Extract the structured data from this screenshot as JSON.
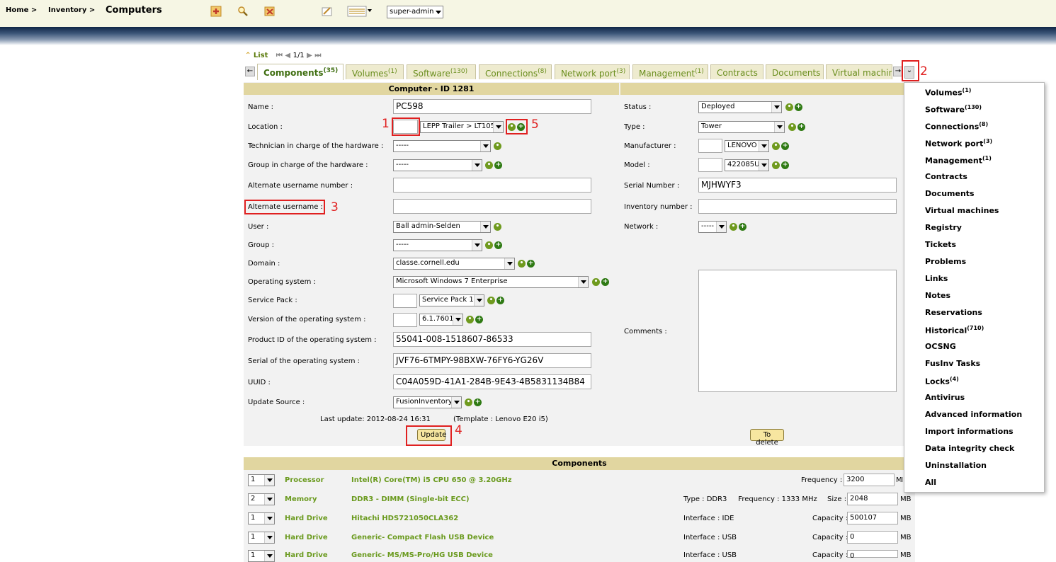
{
  "header": {
    "breadcrumb": [
      "Home >",
      "Inventory >"
    ],
    "title": "Computers",
    "profile_select": "super-admin"
  },
  "list_nav": {
    "label": "List",
    "pager": "1/1"
  },
  "tabs": [
    {
      "label": "Components",
      "count": "(35)"
    },
    {
      "label": "Volumes",
      "count": "(1)"
    },
    {
      "label": "Software",
      "count": "(130)"
    },
    {
      "label": "Connections",
      "count": "(8)"
    },
    {
      "label": "Network port",
      "count": "(3)"
    },
    {
      "label": "Management",
      "count": "(1)"
    },
    {
      "label": "Contracts",
      "count": ""
    },
    {
      "label": "Documents",
      "count": ""
    },
    {
      "label": "Virtual machin",
      "count": ""
    }
  ],
  "form": {
    "header": "Computer - ID 1281",
    "left": [
      {
        "label": "Name :",
        "value": "PC598"
      },
      {
        "label": "Location :",
        "value": "LEPP Trailer > LT105"
      },
      {
        "label": "Technician in charge of the hardware :",
        "value": "-----"
      },
      {
        "label": "Group in charge of the hardware :",
        "value": "-----"
      },
      {
        "label": "Alternate username number :",
        "value": ""
      },
      {
        "label": "Alternate username :",
        "value": ""
      },
      {
        "label": "User :",
        "value": "Ball admin-Selden"
      },
      {
        "label": "Group :",
        "value": "-----"
      },
      {
        "label": "Domain :",
        "value": "classe.cornell.edu"
      },
      {
        "label": "Operating system :",
        "value": "Microsoft Windows 7 Enterprise"
      },
      {
        "label": "Service Pack :",
        "value": "Service Pack 1"
      },
      {
        "label": "Version of the operating system :",
        "value": "6.1.7601"
      },
      {
        "label": "Product ID of the operating system :",
        "value": "55041-008-1518607-86533"
      },
      {
        "label": "Serial of the operating system :",
        "value": "JVF76-6TMPY-98BXW-76FY6-YG26V"
      },
      {
        "label": "UUID :",
        "value": "C04A059D-41A1-284B-9E43-4B5831134B84"
      },
      {
        "label": "Update Source :",
        "value": "FusionInventory"
      }
    ],
    "right": [
      {
        "label": "Status :",
        "value": "Deployed"
      },
      {
        "label": "Type :",
        "value": "Tower"
      },
      {
        "label": "Manufacturer :",
        "value": "LENOVO"
      },
      {
        "label": "Model :",
        "value": "422085U"
      },
      {
        "label": "Serial Number :",
        "value": "MJHWYF3"
      },
      {
        "label": "Inventory number :",
        "value": ""
      },
      {
        "label": "Network :",
        "value": "-----"
      },
      {
        "label": "Comments :",
        "value": ""
      }
    ],
    "last_update": "Last update: 2012-08-24 16:31",
    "template": "(Template : Lenovo E20 i5)",
    "update_button": "Update",
    "delete_button": "To delete"
  },
  "annotations": [
    "1",
    "2",
    "3",
    "4",
    "5"
  ],
  "components": {
    "header": "Components",
    "rows": [
      {
        "qty": "1",
        "type": "Processor",
        "name": "Intel(R) Core(TM) i5 CPU 650 @ 3.20GHz",
        "info": "",
        "field": "Frequency :",
        "value": "3200",
        "unit": "MHz"
      },
      {
        "qty": "2",
        "type": "Memory",
        "name": "DDR3 - DIMM (Single-bit ECC)",
        "info": "Type : DDR3     Frequency : 1333 MHz",
        "field": "Size :",
        "value": "2048",
        "unit": "MB"
      },
      {
        "qty": "1",
        "type": "Hard Drive",
        "name": "Hitachi HDS721050CLA362",
        "info": "Interface : IDE",
        "field": "Capacity :",
        "value": "500107",
        "unit": "MB"
      },
      {
        "qty": "1",
        "type": "Hard Drive",
        "name": "Generic- Compact Flash USB Device",
        "info": "Interface : USB",
        "field": "Capacity :",
        "value": "0",
        "unit": "MB"
      },
      {
        "qty": "1",
        "type": "Hard Drive",
        "name": "Generic- MS/MS-Pro/HG USB Device",
        "info": "Interface : USB",
        "field": "Capacity :",
        "value": "0",
        "unit": "MB"
      }
    ]
  },
  "menu": [
    {
      "label": "Volumes",
      "count": "(1)"
    },
    {
      "label": "Software",
      "count": "(130)"
    },
    {
      "label": "Connections",
      "count": "(8)"
    },
    {
      "label": "Network port",
      "count": "(3)"
    },
    {
      "label": "Management",
      "count": "(1)"
    },
    {
      "label": "Contracts",
      "count": ""
    },
    {
      "label": "Documents",
      "count": ""
    },
    {
      "label": "Virtual machines",
      "count": ""
    },
    {
      "label": "Registry",
      "count": ""
    },
    {
      "label": "Tickets",
      "count": ""
    },
    {
      "label": "Problems",
      "count": ""
    },
    {
      "label": "Links",
      "count": ""
    },
    {
      "label": "Notes",
      "count": ""
    },
    {
      "label": "Reservations",
      "count": ""
    },
    {
      "label": "Historical",
      "count": "(710)"
    },
    {
      "label": "OCSNG",
      "count": ""
    },
    {
      "label": "FusInv Tasks",
      "count": ""
    },
    {
      "label": "Locks",
      "count": "(4)"
    },
    {
      "label": "Antivirus",
      "count": ""
    },
    {
      "label": "Advanced information",
      "count": ""
    },
    {
      "label": "Import informations",
      "count": ""
    },
    {
      "label": "Data integrity check",
      "count": ""
    },
    {
      "label": "Uninstallation",
      "count": ""
    },
    {
      "label": "All",
      "count": ""
    }
  ]
}
